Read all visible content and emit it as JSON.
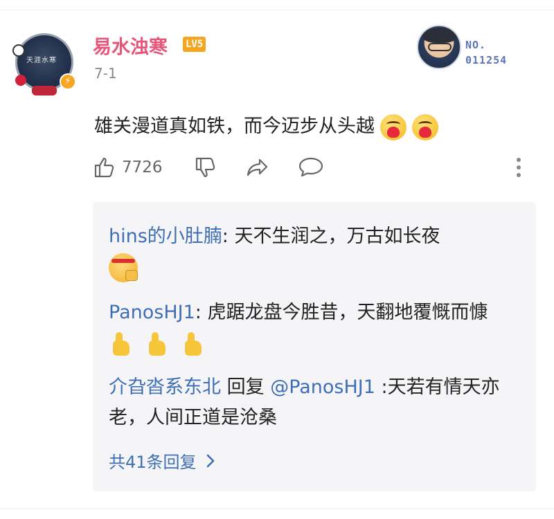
{
  "post": {
    "username": "易水浊寒",
    "level": "LV5",
    "date": "7-1",
    "avatar_caption": "天涯水寒",
    "text": "雄关漫道真如铁，而今迈步从头越"
  },
  "medal": {
    "no_label": "NO.",
    "number": "011254"
  },
  "actions": {
    "like_count": "7726"
  },
  "replies": [
    {
      "user": "hins的小肚腩",
      "text": "天不生润之，万古如长夜"
    },
    {
      "user": "PanosHJ1",
      "text": "虎踞龙盘今胜昔，天翻地覆慨而慷"
    },
    {
      "user": "介旮沓系东北",
      "reply_word": "回复",
      "mention": "@PanosHJ1",
      "text": ":天若有情天亦老，人间正道是沧桑"
    }
  ],
  "see_all": "共41条回复",
  "colors": {
    "username": "#e8557a",
    "link": "#3e6fb5",
    "level_badge": "#f4a623",
    "reply_bg": "#f5f5f7"
  }
}
